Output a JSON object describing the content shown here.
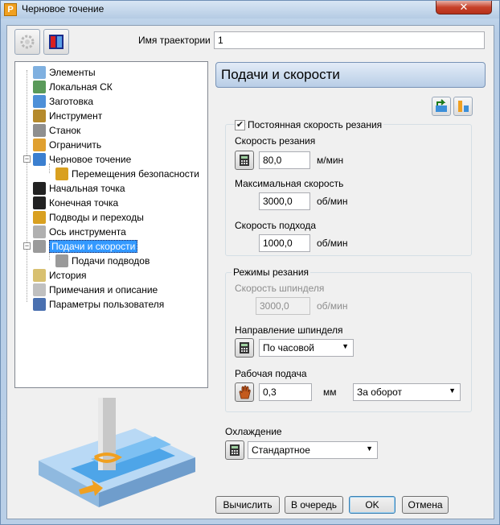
{
  "window": {
    "title": "Черновое точение",
    "app_icon_letter": "P",
    "close_glyph": "✕"
  },
  "colors": {
    "accent": "#3399ff",
    "header_bg": "#b8cde6",
    "tool_blue": "#4ea5e8"
  },
  "toolbar": {
    "left_icon": "gear-disabled-icon",
    "right_icon": "strategy-icon"
  },
  "trajectory": {
    "label": "Имя траектории",
    "value": "1"
  },
  "tree": {
    "items": [
      {
        "label": "Элементы",
        "icon": "features-icon"
      },
      {
        "label": "Локальная СК",
        "icon": "workplane-icon"
      },
      {
        "label": "Заготовка",
        "icon": "block-icon"
      },
      {
        "label": "Инструмент",
        "icon": "tool-icon"
      },
      {
        "label": "Станок",
        "icon": "machine-icon"
      },
      {
        "label": "Ограничить",
        "icon": "limit-icon"
      },
      {
        "label": "Черновое точение",
        "icon": "rough-turning-icon",
        "expander": "−"
      },
      {
        "label": "Перемещения безопасности",
        "icon": "safe-moves-icon"
      },
      {
        "label": "Начальная точка",
        "icon": "start-point-icon"
      },
      {
        "label": "Конечная точка",
        "icon": "end-point-icon"
      },
      {
        "label": "Подводы и переходы",
        "icon": "leads-links-icon"
      },
      {
        "label": "Ось инструмента",
        "icon": "tool-axis-icon"
      },
      {
        "label": "Подачи и скорости",
        "icon": "feeds-speeds-icon",
        "expander": "−"
      },
      {
        "label": "Подачи подводов",
        "icon": "lead-feeds-icon"
      },
      {
        "label": "История",
        "icon": "history-icon"
      },
      {
        "label": "Примечания и описание",
        "icon": "notes-icon"
      },
      {
        "label": "Параметры пользователя",
        "icon": "user-params-icon"
      }
    ]
  },
  "panel": {
    "title": "Подачи и скорости",
    "top_icons": [
      "load-feeds-icon",
      "reset-feeds-icon"
    ],
    "constant_cutting_speed": {
      "checkbox_label": "Постоянная скорость резания",
      "checked": true,
      "check_glyph": "✔",
      "cutting_speed": {
        "label": "Скорость резания",
        "value": "80,0",
        "unit": "м/мин"
      },
      "max_speed": {
        "label": "Максимальная скорость",
        "value": "3000,0",
        "unit": "об/мин"
      },
      "approach_speed": {
        "label": "Скорость подхода",
        "value": "1000,0",
        "unit": "об/мин"
      }
    },
    "cutting_modes": {
      "title": "Режимы резания",
      "spindle_speed": {
        "label": "Скорость шпинделя",
        "value": "3000,0",
        "unit": "об/мин"
      },
      "spindle_direction": {
        "label": "Направление шпинделя",
        "value": "По часовой"
      },
      "work_feed": {
        "label": "Рабочая подача",
        "value": "0,3",
        "unit": "мм",
        "mode": "За оборот"
      }
    },
    "cooling": {
      "label": "Охлаждение",
      "value": "Стандартное"
    }
  },
  "buttons": {
    "calculate": "Вычислить",
    "queue": "В очередь",
    "ok": "OK",
    "cancel": "Отмена"
  },
  "dropdown_arrow": "▼"
}
